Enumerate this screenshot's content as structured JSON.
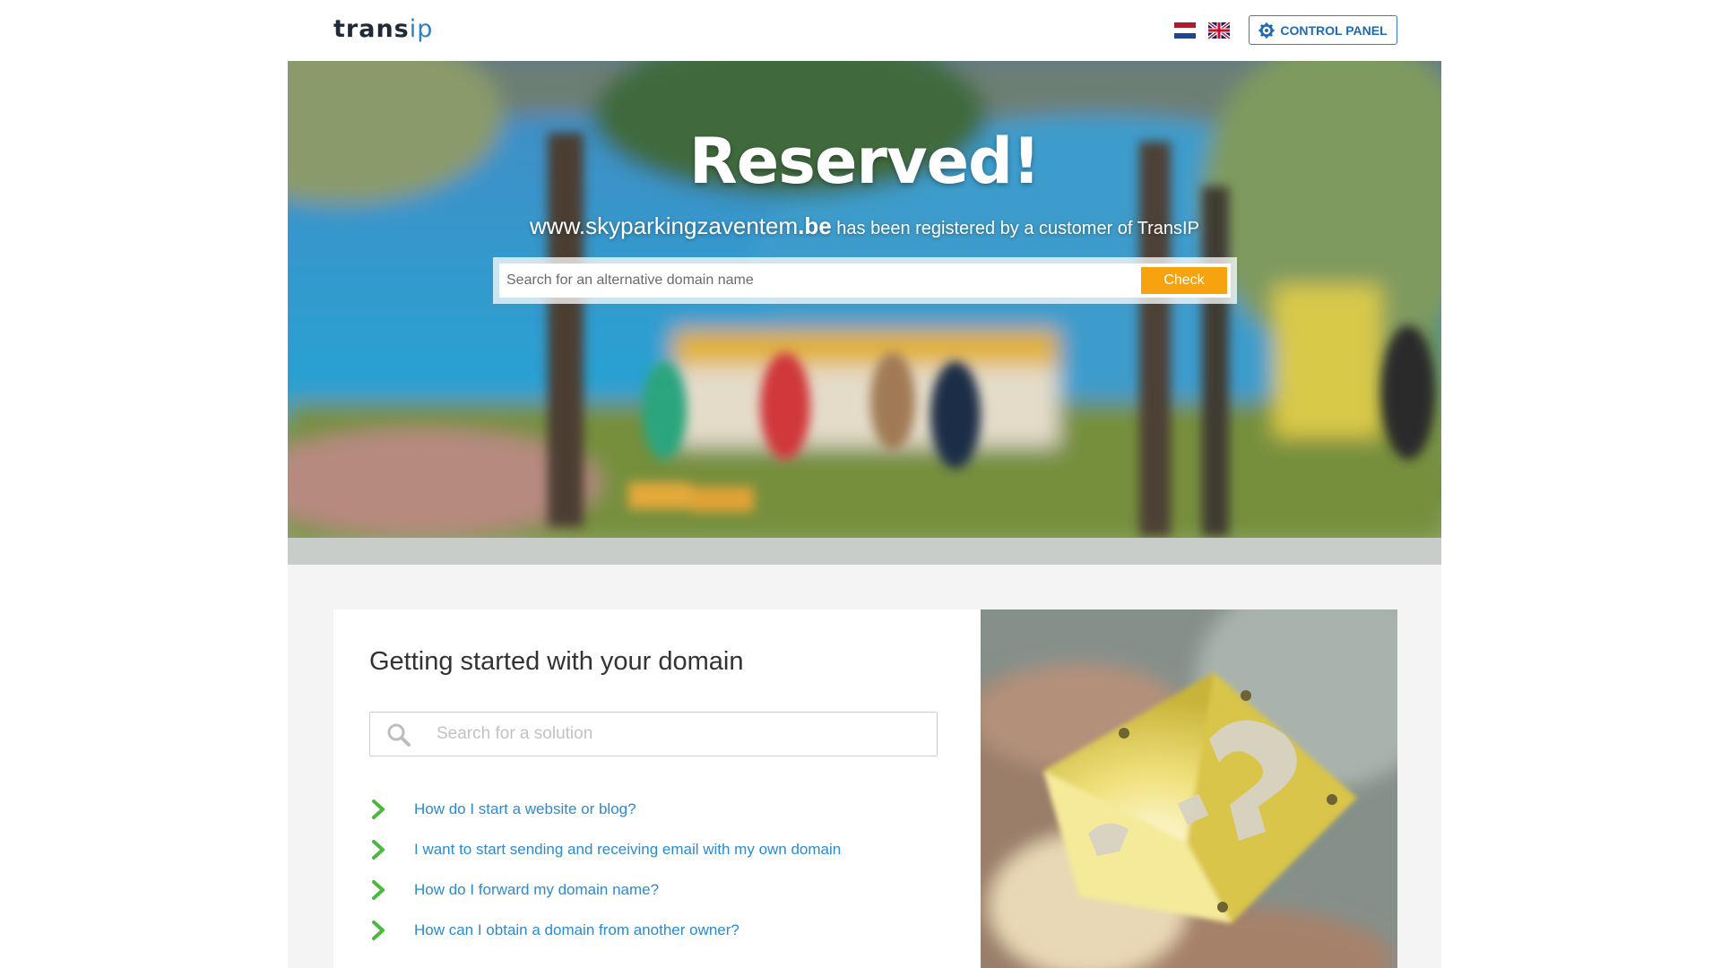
{
  "header": {
    "logo_main": "trans",
    "logo_accent": "ip",
    "languages": [
      "Nederlands",
      "English"
    ],
    "control_panel_label": "CONTROL PANEL"
  },
  "hero": {
    "title": "Reserved!",
    "domain_name": "www.skyparkingzaventem",
    "domain_tld": ".be",
    "registered_text": " has been registered by a customer of TransIP",
    "search_placeholder": "Search for an alternative domain name",
    "check_label": "Check"
  },
  "getting_started": {
    "title": "Getting started with your domain",
    "search_placeholder": "Search for a solution",
    "faq": [
      "How do I start a website or blog?",
      "I want to start sending and receiving email with my own domain",
      "How do I forward my domain name?",
      "How can I obtain a domain from another owner?"
    ]
  },
  "colors": {
    "accent_blue": "#2f7fc4",
    "link_blue": "#2a8bd1",
    "check_orange": "#f7a20f",
    "chevron_green": "#4cb83e"
  },
  "icons": {
    "control_panel": "gear-icon",
    "solution_search": "search-icon",
    "faq_bullet": "chevron-right-icon"
  }
}
